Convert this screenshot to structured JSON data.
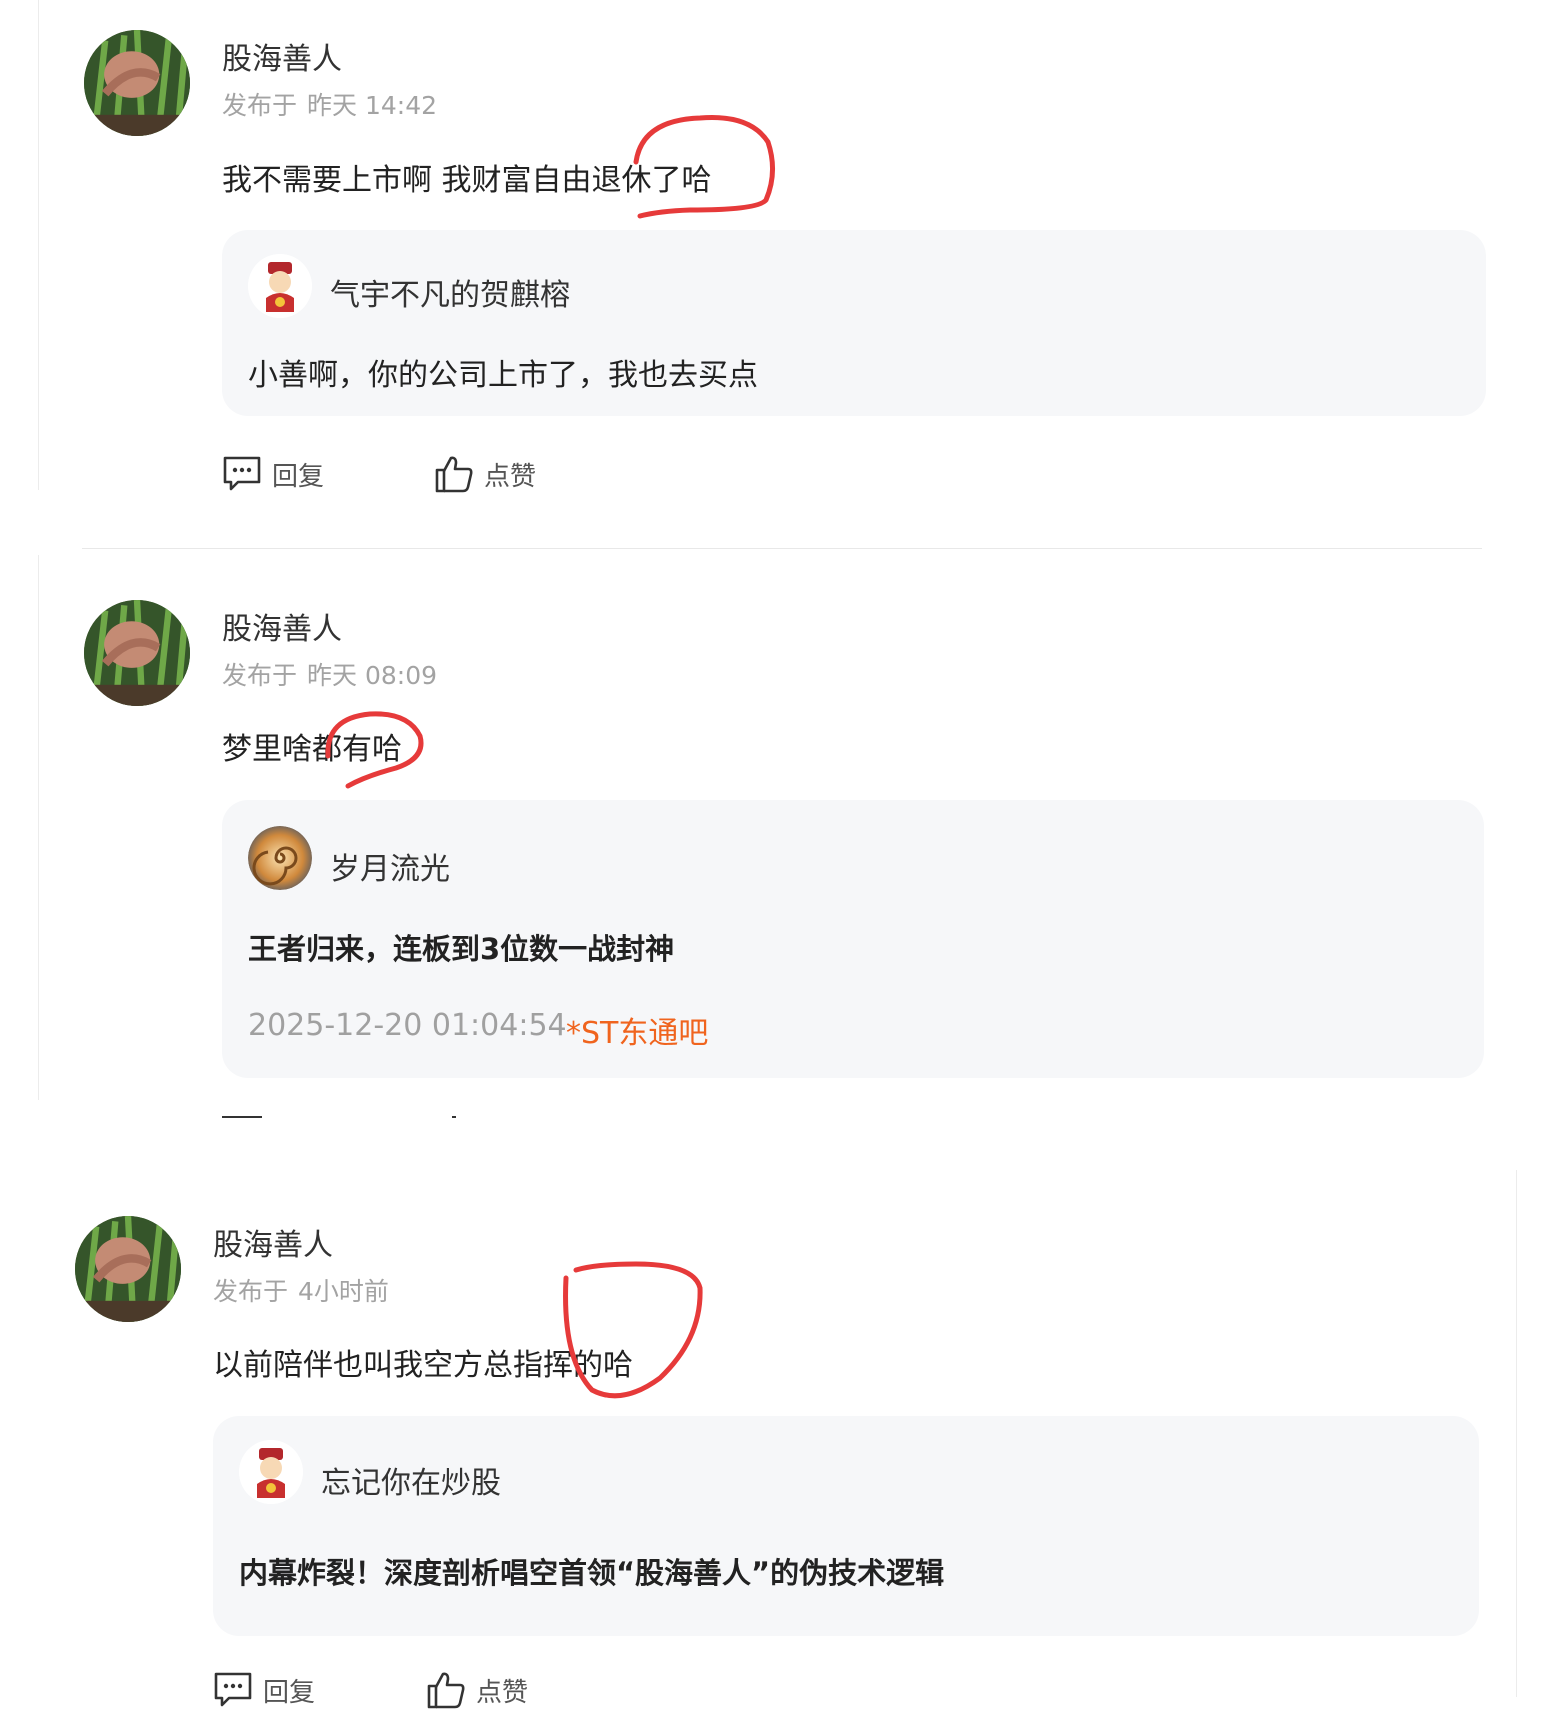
{
  "comments": [
    {
      "username": "股海善人",
      "meta_prefix": "发布于",
      "meta_time": "昨天 14:42",
      "content": "我不需要上市啊 我财富自由退休了哈",
      "quote": {
        "author": "气宇不凡的贺麒榕",
        "text": "小善啊，你的公司上市了，我也去买点"
      },
      "actions": {
        "reply": "回复",
        "like": "点赞"
      }
    },
    {
      "username": "股海善人",
      "meta_prefix": "发布于",
      "meta_time": "昨天 08:09",
      "content": "梦里啥都有哈",
      "quote": {
        "author": "岁月流光",
        "title": "王者归来，连板到3位数一战封神",
        "date": "2025-12-20 01:04:54",
        "bar": "*ST东通吧"
      }
    },
    {
      "username": "股海善人",
      "meta_prefix": "发布于",
      "meta_time": "4小时前",
      "content": "以前陪伴也叫我空方总指挥的哈",
      "quote": {
        "author": "忘记你在炒股",
        "title": "内幕炸裂！深度剖析唱空首领“股海善人”的伪技术逻辑"
      },
      "actions": {
        "reply": "回复",
        "like": "点赞"
      }
    }
  ],
  "colors": {
    "annotation": "#e63a3a",
    "bar_link": "#f0641e",
    "quote_bg": "#f6f7f9"
  },
  "icons": [
    "comment-icon",
    "thumbs-up-icon",
    "avatar-plant-photo",
    "avatar-fortune-god",
    "avatar-swirl"
  ]
}
